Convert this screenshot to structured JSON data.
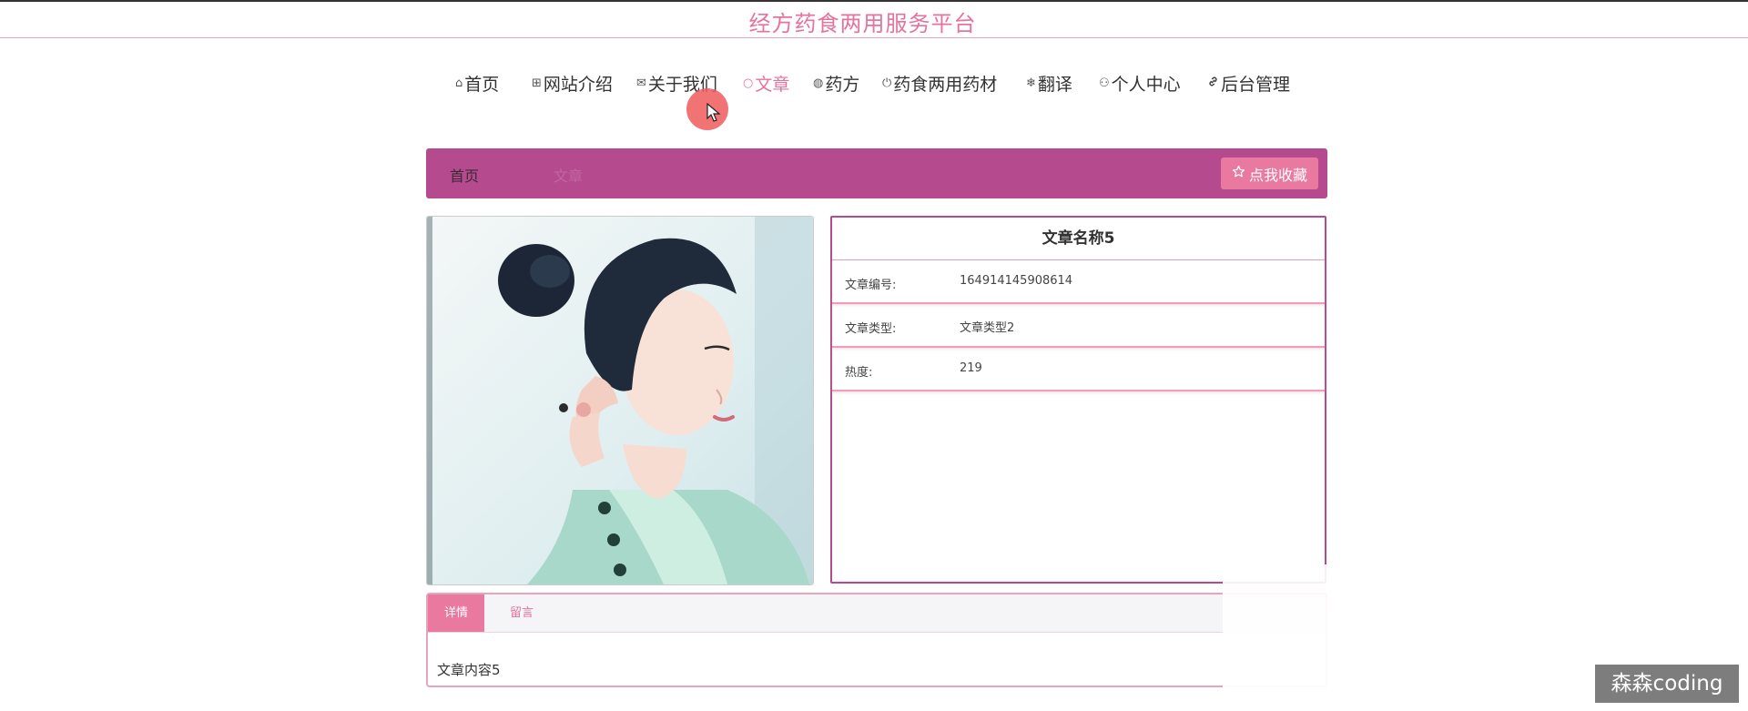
{
  "site": {
    "title": "经方药食两用服务平台"
  },
  "nav": {
    "items": [
      {
        "label": "首页",
        "icon": "home-icon",
        "glyph": "⌂"
      },
      {
        "label": "网站介绍",
        "icon": "grid-icon",
        "glyph": "⊞"
      },
      {
        "label": "关于我们",
        "icon": "mail-icon",
        "glyph": "✉"
      },
      {
        "label": "文章",
        "icon": "circle-icon",
        "glyph": "○"
      },
      {
        "label": "药方",
        "icon": "globe-icon",
        "glyph": "◍"
      },
      {
        "label": "药食两用药材",
        "icon": "power-icon",
        "glyph": "⏻"
      },
      {
        "label": "翻译",
        "icon": "snowflake-icon",
        "glyph": "❄"
      },
      {
        "label": "个人中心",
        "icon": "user-icon",
        "glyph": "⚇"
      },
      {
        "label": "后台管理",
        "icon": "link-icon",
        "glyph": "🔗"
      }
    ],
    "active_label": "文章"
  },
  "breadcrumb": {
    "home": "首页",
    "current": "文章",
    "favorite_button": "点我收藏"
  },
  "article": {
    "title": "文章名称5",
    "fields": [
      {
        "label": "文章编号:",
        "value": "164914145908614"
      },
      {
        "label": "文章类型:",
        "value": "文章类型2"
      },
      {
        "label": "热度:",
        "value": "219"
      }
    ]
  },
  "tabs": {
    "items": [
      {
        "label": "详情"
      },
      {
        "label": "留言"
      }
    ],
    "content": "文章内容5"
  },
  "watermark": "森森coding",
  "colors": {
    "accent": "#e5739c",
    "breadcrumb_bg": "#b64a8e",
    "tab_active": "#e9799f"
  }
}
